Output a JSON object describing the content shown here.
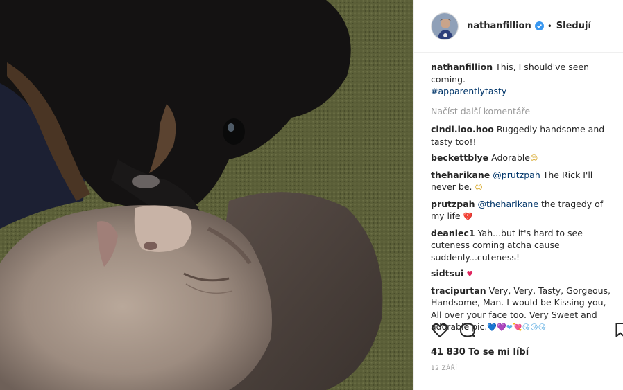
{
  "post": {
    "username": "nathanfillion",
    "follow_label": "Sledují",
    "dot": "•",
    "caption": "This, I should've seen coming.",
    "hashtag": "#apparentlytasty",
    "load_more": "Načíst další komentáře",
    "likes": "41 830 To se mi líbí",
    "date": "12 ZÁŘÍ"
  },
  "comments": [
    {
      "user": "cindi.loo.hoo",
      "text": "Ruggedly handsome and tasty too!!"
    },
    {
      "user": "beckettblye",
      "text": "Adorable",
      "emoji": "😍"
    },
    {
      "user": "theharikane",
      "mention": "@prutzpah",
      "text": "The Rick I'll never be.",
      "emoji": "😊"
    },
    {
      "user": "prutzpah",
      "mention": "@theharikane",
      "text": "the tragedy of my life",
      "emoji": "💔"
    },
    {
      "user": "deaniec1",
      "text": "Yah...but it's hard to see cuteness coming atcha cause suddenly...cuteness!"
    },
    {
      "user": "sidtsui",
      "emoji": "♥"
    },
    {
      "user": "tracipurtan",
      "text": "Very, Very, Tasty, Gorgeous, Handsome, Man. I would be Kissing you, All over your face too. Very Sweet and adorable pic.",
      "emoji": "💙💜❤💘😘😘😘"
    }
  ],
  "icons": [
    "heart-icon",
    "comment-icon",
    "bookmark-icon",
    "verified-badge-icon"
  ],
  "colors": {
    "verified": "#3897f0",
    "link": "#003569",
    "muted": "#999999",
    "heart": "#ed4956"
  }
}
